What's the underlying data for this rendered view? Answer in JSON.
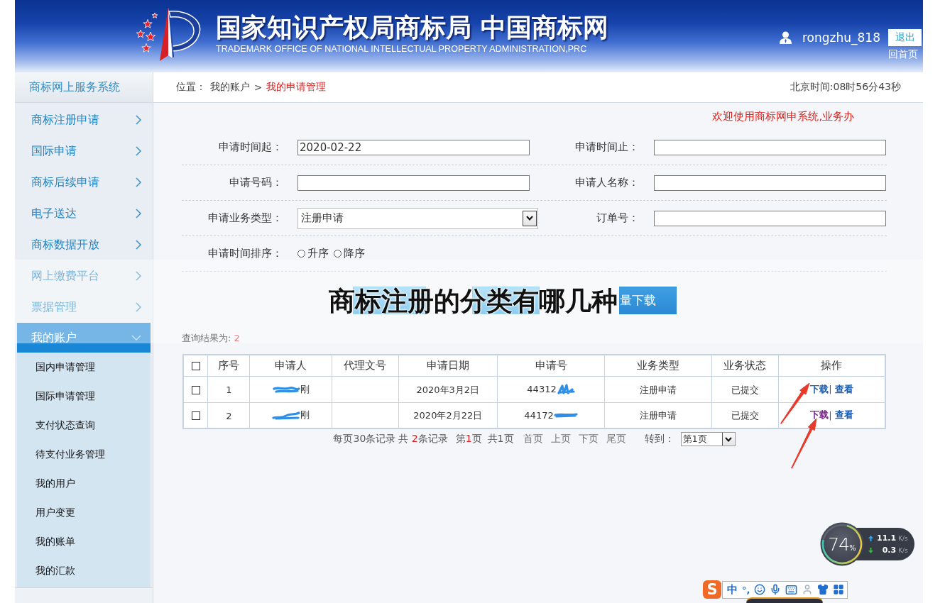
{
  "header": {
    "title": "国家知识产权局商标局 中国商标网",
    "subtitle": "TRADEMARK OFFICE OF NATIONAL INTELLECTUAL PROPERTY ADMINISTRATION,PRC",
    "username": "rongzhu_818",
    "logout_button": "退出",
    "home_link": "回首页"
  },
  "system_name": "商标网上服务系统",
  "breadcrumb": {
    "label": "位置：",
    "separator": ">",
    "items": [
      {
        "label": "我的账户",
        "current": false
      },
      {
        "label": "我的申请管理",
        "current": true
      }
    ]
  },
  "clock": "北京时间:08时56分43秒",
  "sidebar": {
    "items": [
      {
        "label": "商标注册申请",
        "expanded": false
      },
      {
        "label": "国际申请",
        "expanded": false
      },
      {
        "label": "商标后续申请",
        "expanded": false
      },
      {
        "label": "电子送达",
        "expanded": false
      },
      {
        "label": "商标数据开放",
        "expanded": false
      },
      {
        "label": "网上缴费平台",
        "expanded": false
      },
      {
        "label": "票据管理",
        "expanded": false
      },
      {
        "label": "我的账户",
        "expanded": true,
        "children": [
          {
            "label": "国内申请管理",
            "selected": false
          },
          {
            "label": "国际申请管理",
            "selected": false
          },
          {
            "label": "支付状态查询",
            "selected": false
          },
          {
            "label": "待支付业务管理",
            "selected": false
          },
          {
            "label": "我的用户",
            "selected": false
          },
          {
            "label": "用户变更",
            "selected": false
          },
          {
            "label": "我的账单",
            "selected": false
          },
          {
            "label": "我的汇款",
            "selected": false
          }
        ]
      }
    ]
  },
  "notice": "欢迎使用商标网申系统,业务办",
  "form": {
    "rows": [
      [
        {
          "kind": "text",
          "label": "申请时间起：",
          "value": "2020-02-22"
        },
        {
          "kind": "text",
          "label": "申请时间止："
        }
      ],
      [
        {
          "kind": "text",
          "label": "申请号码："
        },
        {
          "kind": "text",
          "label": "申请人名称："
        }
      ],
      [
        {
          "kind": "select",
          "label": "申请业务类型：",
          "value": "注册申请"
        },
        {
          "kind": "text",
          "label": "订单号："
        }
      ],
      [
        {
          "kind": "radio",
          "label": "申请时间排序：",
          "options": [
            {
              "label": "升序",
              "selected": false
            },
            {
              "label": "降序",
              "selected": false
            }
          ]
        }
      ]
    ]
  },
  "buttons": [
    {
      "label": "量下载"
    }
  ],
  "overlay_banner": {
    "title": "商标注册的分类有哪几种"
  },
  "result": {
    "label": "查询结果为:",
    "count": "2"
  },
  "table": {
    "select_all": {
      "checked": false
    },
    "columns": [
      "序号",
      "申请人",
      "代理文号",
      "申请日期",
      "申请号",
      "业务类型",
      "业务状态",
      "操作"
    ],
    "action_separator": "|",
    "rows": [
      {
        "checked": false,
        "number": "1",
        "applicant": "刚",
        "redacted": true,
        "date": "2020年3月2日",
        "application_no": "44312",
        "type": "注册申请",
        "status": "已提交",
        "actions": [
          {
            "label": "下载",
            "visited": false
          },
          {
            "label": "查看",
            "visited": false
          }
        ]
      },
      {
        "checked": false,
        "number": "2",
        "applicant": "刚",
        "redacted": true,
        "date": "2020年2月22日",
        "application_no": "44172",
        "type": "注册申请",
        "status": "已提交",
        "actions": [
          {
            "label": "下载",
            "visited": true
          },
          {
            "label": "查看",
            "visited": false
          }
        ]
      }
    ]
  },
  "pagination": {
    "per_page": "每页30条记录",
    "total_prefix": "共",
    "total_count": "2",
    "total_suffix": "条记录",
    "page_prefix": "第",
    "page_current": "1",
    "page_suffix": "页",
    "page_total": "共1页",
    "links": [
      "首页",
      "上页",
      "下页",
      "尾页"
    ],
    "goto_label": "转到：",
    "goto_value": "第1页"
  },
  "net_meter": {
    "percent": "74",
    "percent_unit": "%",
    "upload": "11.1",
    "upload_unit": "K/s",
    "download": "0.3",
    "download_unit": "K/s"
  },
  "ime_toolbar": {
    "logo": "S",
    "mode": "中",
    "punctuation": "°,"
  }
}
